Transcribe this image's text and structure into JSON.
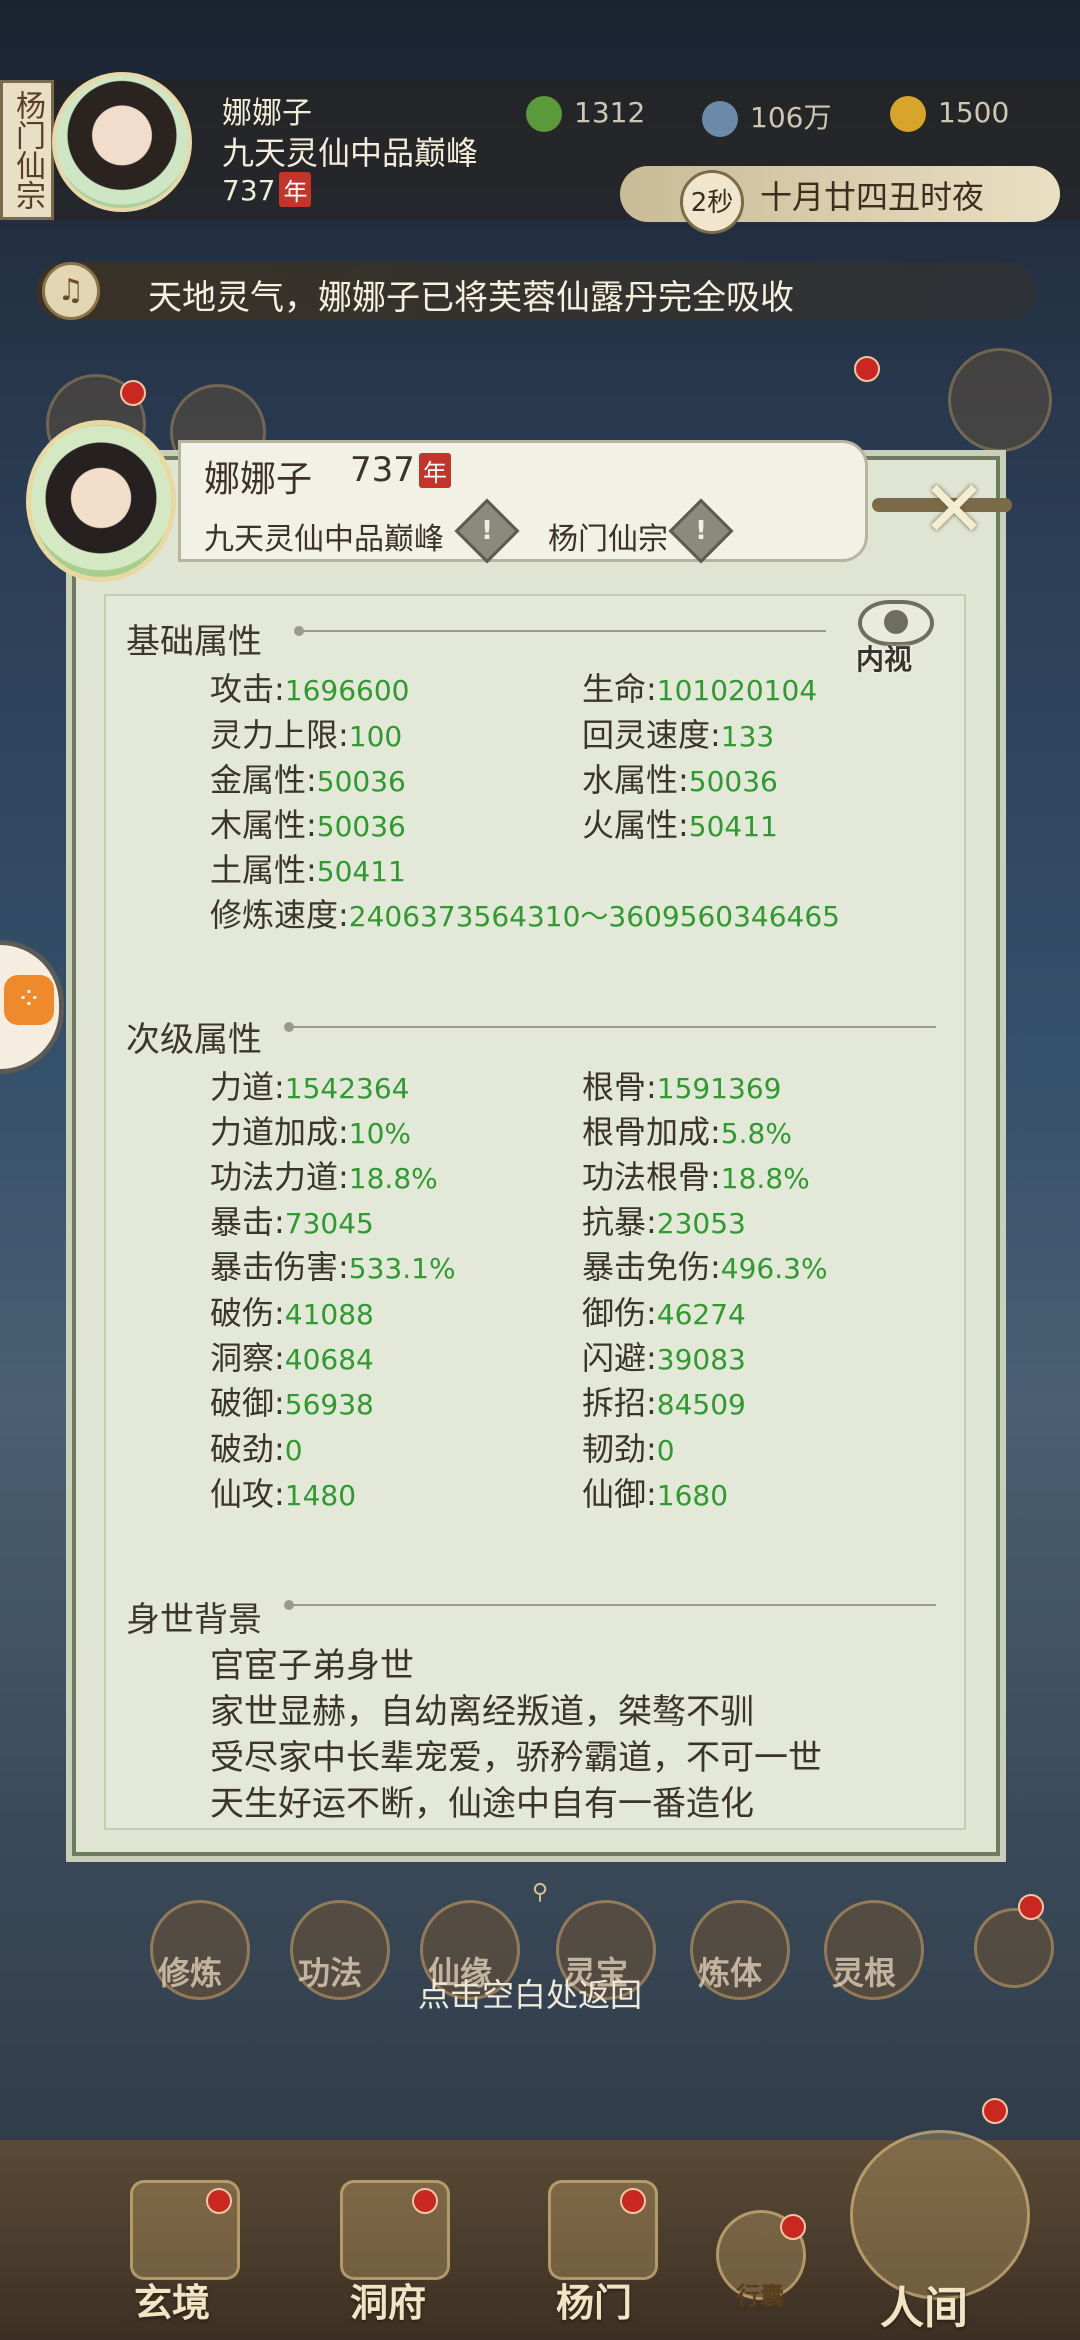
{
  "header": {
    "sect_tab": "杨门仙宗",
    "name": "娜娜子",
    "realm": "九天灵仙中品巅峰",
    "age": "737",
    "age_unit": "年",
    "resources": [
      {
        "icon": "leaf-icon",
        "value": "1312",
        "color": "#5a9a3a"
      },
      {
        "icon": "coin-icon",
        "value": "106万",
        "color": "#6a8aa8"
      },
      {
        "icon": "gold-ingot-icon",
        "value": "1500",
        "color": "#d8a52a"
      }
    ],
    "timer": "2秒",
    "date": "十月廿四丑时夜"
  },
  "notification": {
    "text": "天地灵气，娜娜子已将芙蓉仙露丹完全吸收"
  },
  "popup": {
    "name": "娜娜子",
    "age": "737",
    "age_unit": "年",
    "realm": "九天灵仙中品巅峰",
    "sect": "杨门仙宗",
    "inspect_label": "内视",
    "basic_title": "基础属性",
    "basic": [
      {
        "label": "攻击",
        "value": "1696600"
      },
      {
        "label": "生命",
        "value": "101020104"
      },
      {
        "label": "灵力上限",
        "value": "100"
      },
      {
        "label": "回灵速度",
        "value": "133"
      },
      {
        "label": "金属性",
        "value": "50036"
      },
      {
        "label": "水属性",
        "value": "50036"
      },
      {
        "label": "木属性",
        "value": "50036"
      },
      {
        "label": "火属性",
        "value": "50411"
      },
      {
        "label": "土属性",
        "value": "50411"
      },
      {
        "label": "修炼速度",
        "value": "2406373564310～3609560346465"
      }
    ],
    "secondary_title": "次级属性",
    "secondary": [
      {
        "label": "力道",
        "value": "1542364"
      },
      {
        "label": "根骨",
        "value": "1591369"
      },
      {
        "label": "力道加成",
        "value": "10%"
      },
      {
        "label": "根骨加成",
        "value": "5.8%"
      },
      {
        "label": "功法力道",
        "value": "18.8%"
      },
      {
        "label": "功法根骨",
        "value": "18.8%"
      },
      {
        "label": "暴击",
        "value": "73045"
      },
      {
        "label": "抗暴",
        "value": "23053"
      },
      {
        "label": "暴击伤害",
        "value": "533.1%"
      },
      {
        "label": "暴击免伤",
        "value": "496.3%"
      },
      {
        "label": "破伤",
        "value": "41088"
      },
      {
        "label": "御伤",
        "value": "46274"
      },
      {
        "label": "洞察",
        "value": "40684"
      },
      {
        "label": "闪避",
        "value": "39083"
      },
      {
        "label": "破御",
        "value": "56938"
      },
      {
        "label": "拆招",
        "value": "84509"
      },
      {
        "label": "破劲",
        "value": "0"
      },
      {
        "label": "韧劲",
        "value": "0"
      },
      {
        "label": "仙攻",
        "value": "1480"
      },
      {
        "label": "仙御",
        "value": "1680"
      }
    ],
    "background_title": "身世背景",
    "background": [
      "官宦子弟身世",
      "家世显赫，自幼离经叛道，桀骜不驯",
      "受尽家中长辈宠爱，骄矜霸道，不可一世",
      "天生好运不断，仙途中自有一番造化"
    ]
  },
  "menu": [
    "修炼",
    "功法",
    "仙缘",
    "灵宝",
    "炼体",
    "灵根"
  ],
  "back_hint": "点击空白处返回",
  "nav": [
    "玄境",
    "洞府",
    "杨门",
    "行囊",
    "人间"
  ]
}
